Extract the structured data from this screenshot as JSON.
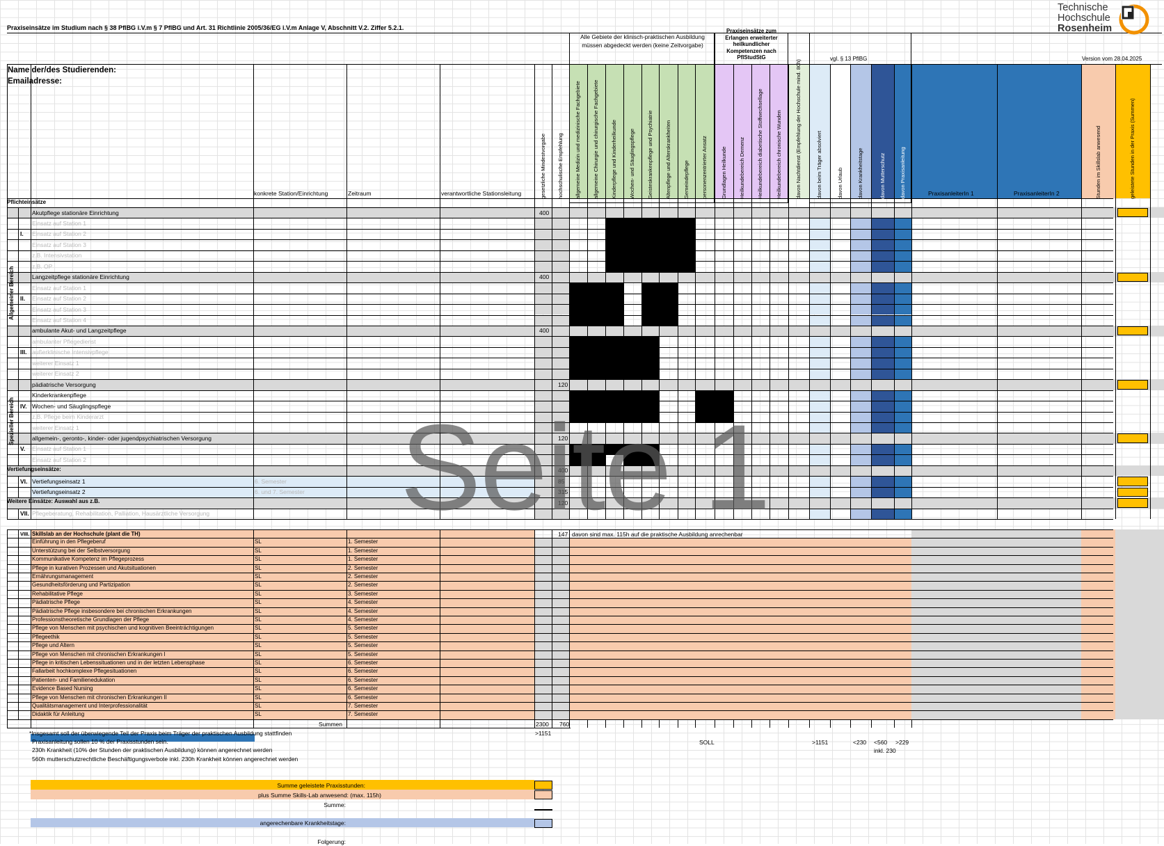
{
  "header": {
    "title": "Praxiseinsätze im Studium nach § 38 PflBG i.V.m § 7 PflBG und Art. 31 Richtlinie 2005/36/EG i.V.m Anlage V, Abschnitt V.2. Ziffer 5.2.1.",
    "name_label": "Name der/des Studierenden:",
    "email_label": "Emailadresse:",
    "version": "Version vom 28.04.2025",
    "group_all_areas": "Alle Gebiete der klinisch-praktischen Ausbildung müssen abgedeckt werden (keine Zeitvorgabe)",
    "group_extended": "Praxiseinsätze zum Erlangen erweiterter heilkundlicher Kompetenzen nach PflStudStG",
    "group_pflbg": "vgl. § 13 PflBG"
  },
  "logo": {
    "line1": "Technische",
    "line2": "Hochschule",
    "line3": "Rosenheim"
  },
  "columns": {
    "station": "konkrete Station/Einrichtung",
    "period": "Zeitraum",
    "lead": "verantwortliche Stationsleitung",
    "leader1": "PraxisanleiterIn 1",
    "leader2": "PraxisanleiterIn 2",
    "vertical": [
      "gesetzliche Mindestvorgabe",
      "hochschulische Empfehlung",
      "allgemeine Medizin und medizinische Fachgebiete",
      "allgemeine Chirurgie und chirurgische Fachgebiete",
      "Kinderpflege und Kinderheilkunde",
      "Wochen- und Säuglingspflege",
      "Geisteskrankenpflege und Psychiatrie",
      "Altenpflege und Alterskrankheiten",
      "Gemeindepflege",
      "personenzentrierter Ansatz",
      "Grundlagen Heilkunde",
      "Heilkundebereich Demenz",
      "Heilkundebereich diabetische Stoffwechsellage",
      "Heilkundebereich chronische Wunden",
      "davon Nachtdienst (Empfehlung der Hochschule mind. 80h)",
      "davon beim Träger absolviert",
      "davon Urlaub",
      "davon Krankheitstage",
      "davon Mutterschutz",
      "davon Praxisanleitung",
      "Stunden im Skillslab anwesend",
      "geleistete Stunden in der Praxis (Summen)"
    ]
  },
  "areas": {
    "general": "Allgemeiner Bereich",
    "special": "Spezieller Bereich"
  },
  "sections": {
    "mandatory": "Pflichteinsätze",
    "deepening": "Vertiefungseinsätze:",
    "further": "Weitere Einsätze: Auswahl aus z.B."
  },
  "rows": [
    {
      "roman": "",
      "label": "Akutpflege stationäre Einrichtung",
      "min": "400",
      "rec": ""
    },
    {
      "label": "Einsatz auf Station 1"
    },
    {
      "roman": "I.",
      "label": "Einsatz auf Station 2"
    },
    {
      "label": "Einsatz auf Station 3"
    },
    {
      "label": "z.B. Intensivstation"
    },
    {
      "label": "z.B. OP"
    },
    {
      "label": "Langzeitpflege stationäre Einrichtung",
      "min": "400"
    },
    {
      "label": "Einsatz auf Station 1"
    },
    {
      "roman": "II.",
      "label": "Einsatz auf Station 2"
    },
    {
      "label": "Einsatz auf Station 3"
    },
    {
      "label": "Einsatz auf Station 4"
    },
    {
      "label": "ambulante Akut- und Langzeitpflege",
      "min": "400"
    },
    {
      "label": "ambulanter Pflegedienst"
    },
    {
      "roman": "III.",
      "label": "außerklinische Intensivpflege"
    },
    {
      "label": "weiterer Einsatz 1"
    },
    {
      "label": "weiterer Einsatz 2"
    },
    {
      "label": "pädiatrische Versorgung",
      "rec": "120"
    },
    {
      "label": "Kinderkrankenpflege"
    },
    {
      "roman": "IV.",
      "label": "Wochen- und Säuglingspflege"
    },
    {
      "label": "z.B. Pflege beim Kinderarzt"
    },
    {
      "label": "weiterer Einsatz 1"
    },
    {
      "label": "allgemein-, geronto-, kinder- oder jugendpsychiatrischen Versorgung",
      "rec": "120"
    },
    {
      "roman": "V.",
      "label": "Einsatz auf Station 1"
    },
    {
      "label": "Einsatz auf Station 2"
    },
    {
      "label": "",
      "rec": "400"
    },
    {
      "roman": "VI.",
      "label": "Vertiefungseinsatz 1",
      "station": "6. Semester",
      "rec": "85"
    },
    {
      "label": "Vertiefungseinsatz 2",
      "station": "6. und 7. Semester",
      "rec": "315"
    },
    {
      "label": "",
      "rec": "120"
    },
    {
      "roman": "VII.",
      "label": "Pflegeberatung, Rehabilitation, Palliation, Hausärztliche Versorgung"
    }
  ],
  "skillslab": {
    "roman": "VIII.",
    "title": "Skillslab an der Hochschule (plant die TH)",
    "rec": "147",
    "note": "davon sind max. 115h auf die praktische Ausbildung anrechenbar",
    "modules": [
      {
        "name": "Einführung in den Pflegeberuf",
        "type": "SL",
        "sem": "1. Semester"
      },
      {
        "name": "Unterstützung bei der Selbstversorgung",
        "type": "SL",
        "sem": "1. Semester"
      },
      {
        "name": "Kommunikative Kompetenz im Pflegeprozess",
        "type": "SL",
        "sem": "1. Semester"
      },
      {
        "name": "Pflege in kurativen Prozessen und Akutsituationen",
        "type": "SL",
        "sem": "2. Semester"
      },
      {
        "name": "Ernährungsmanagement",
        "type": "SL",
        "sem": "2. Semester"
      },
      {
        "name": "Gesundheitsförderung und Partizipation",
        "type": "SL",
        "sem": "2. Semester"
      },
      {
        "name": "Rehabilitative Pflege",
        "type": "SL",
        "sem": "3. Semester"
      },
      {
        "name": "Pädiatrische Pflege",
        "type": "SL",
        "sem": "4. Semester"
      },
      {
        "name": "Pädiatrische Pflege insbesondere bei chronischen Erkrankungen",
        "type": "SL",
        "sem": "4. Semester"
      },
      {
        "name": "Professionstheoretische Grundlagen der Pflege",
        "type": "SL",
        "sem": "4. Semester"
      },
      {
        "name": "Pflege von Menschen mit psychischen und kognitiven Beeinträchtigungen",
        "type": "SL",
        "sem": "5. Semester"
      },
      {
        "name": "Pflegeethik",
        "type": "SL",
        "sem": "5. Semester"
      },
      {
        "name": "Pflege und Altern",
        "type": "SL",
        "sem": "5. Semester"
      },
      {
        "name": "Pflege von Menschen mit chronischen Erkrankungen I",
        "type": "SL",
        "sem": "5. Semester"
      },
      {
        "name": "Pflege in kritischen Lebenssituationen und in der letzten Lebensphase",
        "type": "SL",
        "sem": "6. Semester"
      },
      {
        "name": "Fallarbeit hochkomplexe Pflegesituationen",
        "type": "SL",
        "sem": "6. Semester"
      },
      {
        "name": "Patienten- und Familienedukation",
        "type": "SL",
        "sem": "6. Semester"
      },
      {
        "name": "Evidence Based Nursing",
        "type": "SL",
        "sem": "6. Semester"
      },
      {
        "name": "Pflege von Menschen mit chronischen Erkrankungen II",
        "type": "SL",
        "sem": "6. Semester"
      },
      {
        "name": "Qualitätsmanagement und Interprofessionalität",
        "type": "SL",
        "sem": "7. Semester"
      },
      {
        "name": "Didaktik für Anleitung",
        "type": "SL",
        "sem": "7. Semester"
      }
    ]
  },
  "footer": {
    "sums_label": "Summen",
    "sum_min": "2300",
    "sum_rec": "760",
    "note1": "*Insgesamt soll der überwiegende Teil der Praxis beim Träger der praktischen Ausbildung stattfinden",
    "note1_val": ">1151",
    "note2": "Praxisanleitung sollen 10 % der Praxisstunden sein.",
    "note3": "230h Krankheit (10%  der Stunden der praktischen Ausbildung) können angerechnet werden",
    "note4": "560h mutterschutzrechtliche Beschäftigungsverbote inkl. 230h Krankheit können angerechnet werden",
    "soll": "SOLL",
    "soll_traeger": ">1151",
    "soll_krank": "<230",
    "soll_mutter": "<560",
    "soll_mutter2": "inkl. 230",
    "soll_anleitung": ">229",
    "sum_practice": "Summe geleistete Praxisstunden:",
    "sum_skills": "plus Summe Skills-Lab anwesend: (max. 115h)",
    "sum_total": "Summe:",
    "sick_days": "angerechenbare Krankheitstage:",
    "conclusion": "Folgerung:"
  },
  "watermark": "Seite 1",
  "colors": {
    "green": "#c6e0b4",
    "purple": "#e4c6f5",
    "lightgreen": "#e2efda",
    "lightblue": "#ddebf7",
    "midblue": "#b4c6e7",
    "darkblue": "#2f5597",
    "blue": "#2e75b6",
    "peach": "#f8cbad",
    "orange": "#ffc000",
    "gray": "#d9d9d9"
  }
}
